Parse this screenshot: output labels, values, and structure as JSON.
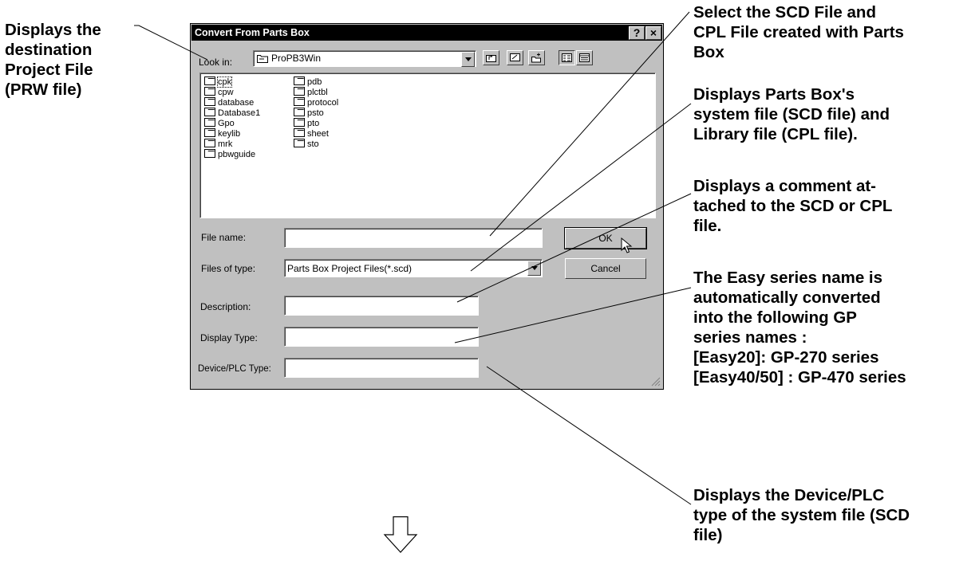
{
  "dialog": {
    "title": "Convert From Parts Box",
    "help_label": "?",
    "close_label": "×",
    "look_in_label": "Look in:",
    "look_in_value": "ProPB3Win",
    "files": [
      {
        "name": "cpk",
        "selected": true
      },
      {
        "name": "cpw"
      },
      {
        "name": "database"
      },
      {
        "name": "Database1"
      },
      {
        "name": "Gpo"
      },
      {
        "name": "keylib"
      },
      {
        "name": "mrk"
      },
      {
        "name": "pbwguide"
      },
      {
        "name": "pdb"
      },
      {
        "name": "plctbl"
      },
      {
        "name": "protocol"
      },
      {
        "name": "psto"
      },
      {
        "name": "pto"
      },
      {
        "name": "sheet"
      },
      {
        "name": "sto"
      }
    ],
    "file_name_label": "File name:",
    "file_name_value": "",
    "files_of_type_label": "Files of type:",
    "files_of_type_value": "Parts Box Project Files(*.scd)",
    "description_label": "Description:",
    "description_value": "",
    "display_type_label": "Display Type:",
    "display_type_value": "",
    "device_plc_type_label": "Device/PLC Type:",
    "device_plc_type_value": "",
    "ok_label": "OK",
    "cancel_label": "Cancel"
  },
  "callouts": {
    "destination": [
      "Displays the",
      "destination",
      "Project File",
      "(PRW file)"
    ],
    "select_file": [
      "Select the SCD File and",
      "CPL File created with Parts",
      "Box"
    ],
    "system_file": [
      "Displays Parts Box's",
      "system file (SCD file) and",
      "Library file (CPL file)."
    ],
    "comment": [
      "Displays a comment at-",
      "tached to the SCD or CPL",
      "file."
    ],
    "easy_series": [
      "The Easy series name is",
      "automatically converted",
      "into the following GP",
      "series names :",
      "[Easy20]: GP-270 series",
      "[Easy40/50] : GP-470 series"
    ],
    "device_plc": [
      "Displays the Device/PLC",
      "type of the system file (SCD",
      "file)"
    ]
  }
}
